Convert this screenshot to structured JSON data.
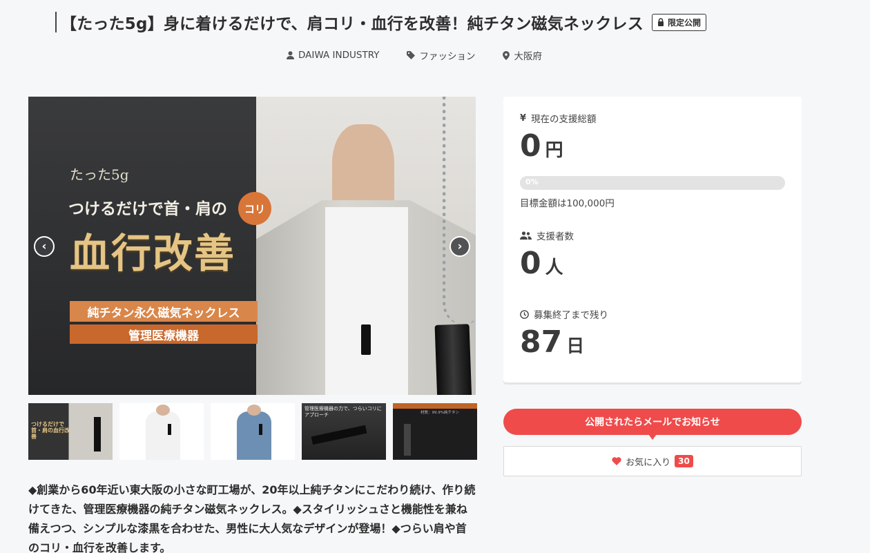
{
  "project": {
    "title": "【たった5g】身に着けるだけで、肩コリ・血行を改善！純チタン磁気ネックレス",
    "visibility_badge": "限定公開"
  },
  "meta": {
    "owner": "DAIWA INDUSTRY",
    "category": "ファッション",
    "location": "大阪府"
  },
  "main_image": {
    "line_small_prefix": "たった",
    "line_small_num": "5g",
    "line_mid": "つけるだけで首・肩の",
    "badge": "コリ",
    "line_big": "血行改善",
    "box1": "純チタン永久磁気ネックレス",
    "box2": "管理医療機器"
  },
  "carousel": {
    "prev_icon": "chevron-left-icon",
    "next_icon": "chevron-right-icon"
  },
  "thumbnails": [
    {
      "text": "つけるだけで首・肩の血行改善"
    },
    {
      "text": ""
    },
    {
      "text": ""
    },
    {
      "text": "管理医療機器の力で、つらいコリにアプローチ"
    },
    {
      "text": "材質：99.9%純チタン"
    }
  ],
  "description": "◆創業から60年近い東大阪の小さな町工場が、20年以上純チタンにこだわり続け、作り続けてきた、管理医療機器の純チタン磁気ネックレス。◆スタイリッシュさと機能性を兼ね備えつつ、シンプルな漆黒を合わせた、男性に大人気なデザインが登場！◆つらい肩や首のコリ・血行を改善します。",
  "stats": {
    "total_label": "現在の支援総額",
    "total_value": "0",
    "total_unit": "円",
    "progress_text": "0%",
    "progress_fraction": 0,
    "goal": "目標金額は100,000円",
    "supporters_label": "支援者数",
    "supporters_value": "0",
    "supporters_unit": "人",
    "remaining_label": "募集終了まで残り",
    "remaining_value": "87",
    "remaining_unit": "日"
  },
  "actions": {
    "notify_label": "公開されたらメールでお知らせ",
    "favorite_label": "お気に入り",
    "favorite_count": "30"
  },
  "colors": {
    "accent": "#ef4b4b"
  }
}
